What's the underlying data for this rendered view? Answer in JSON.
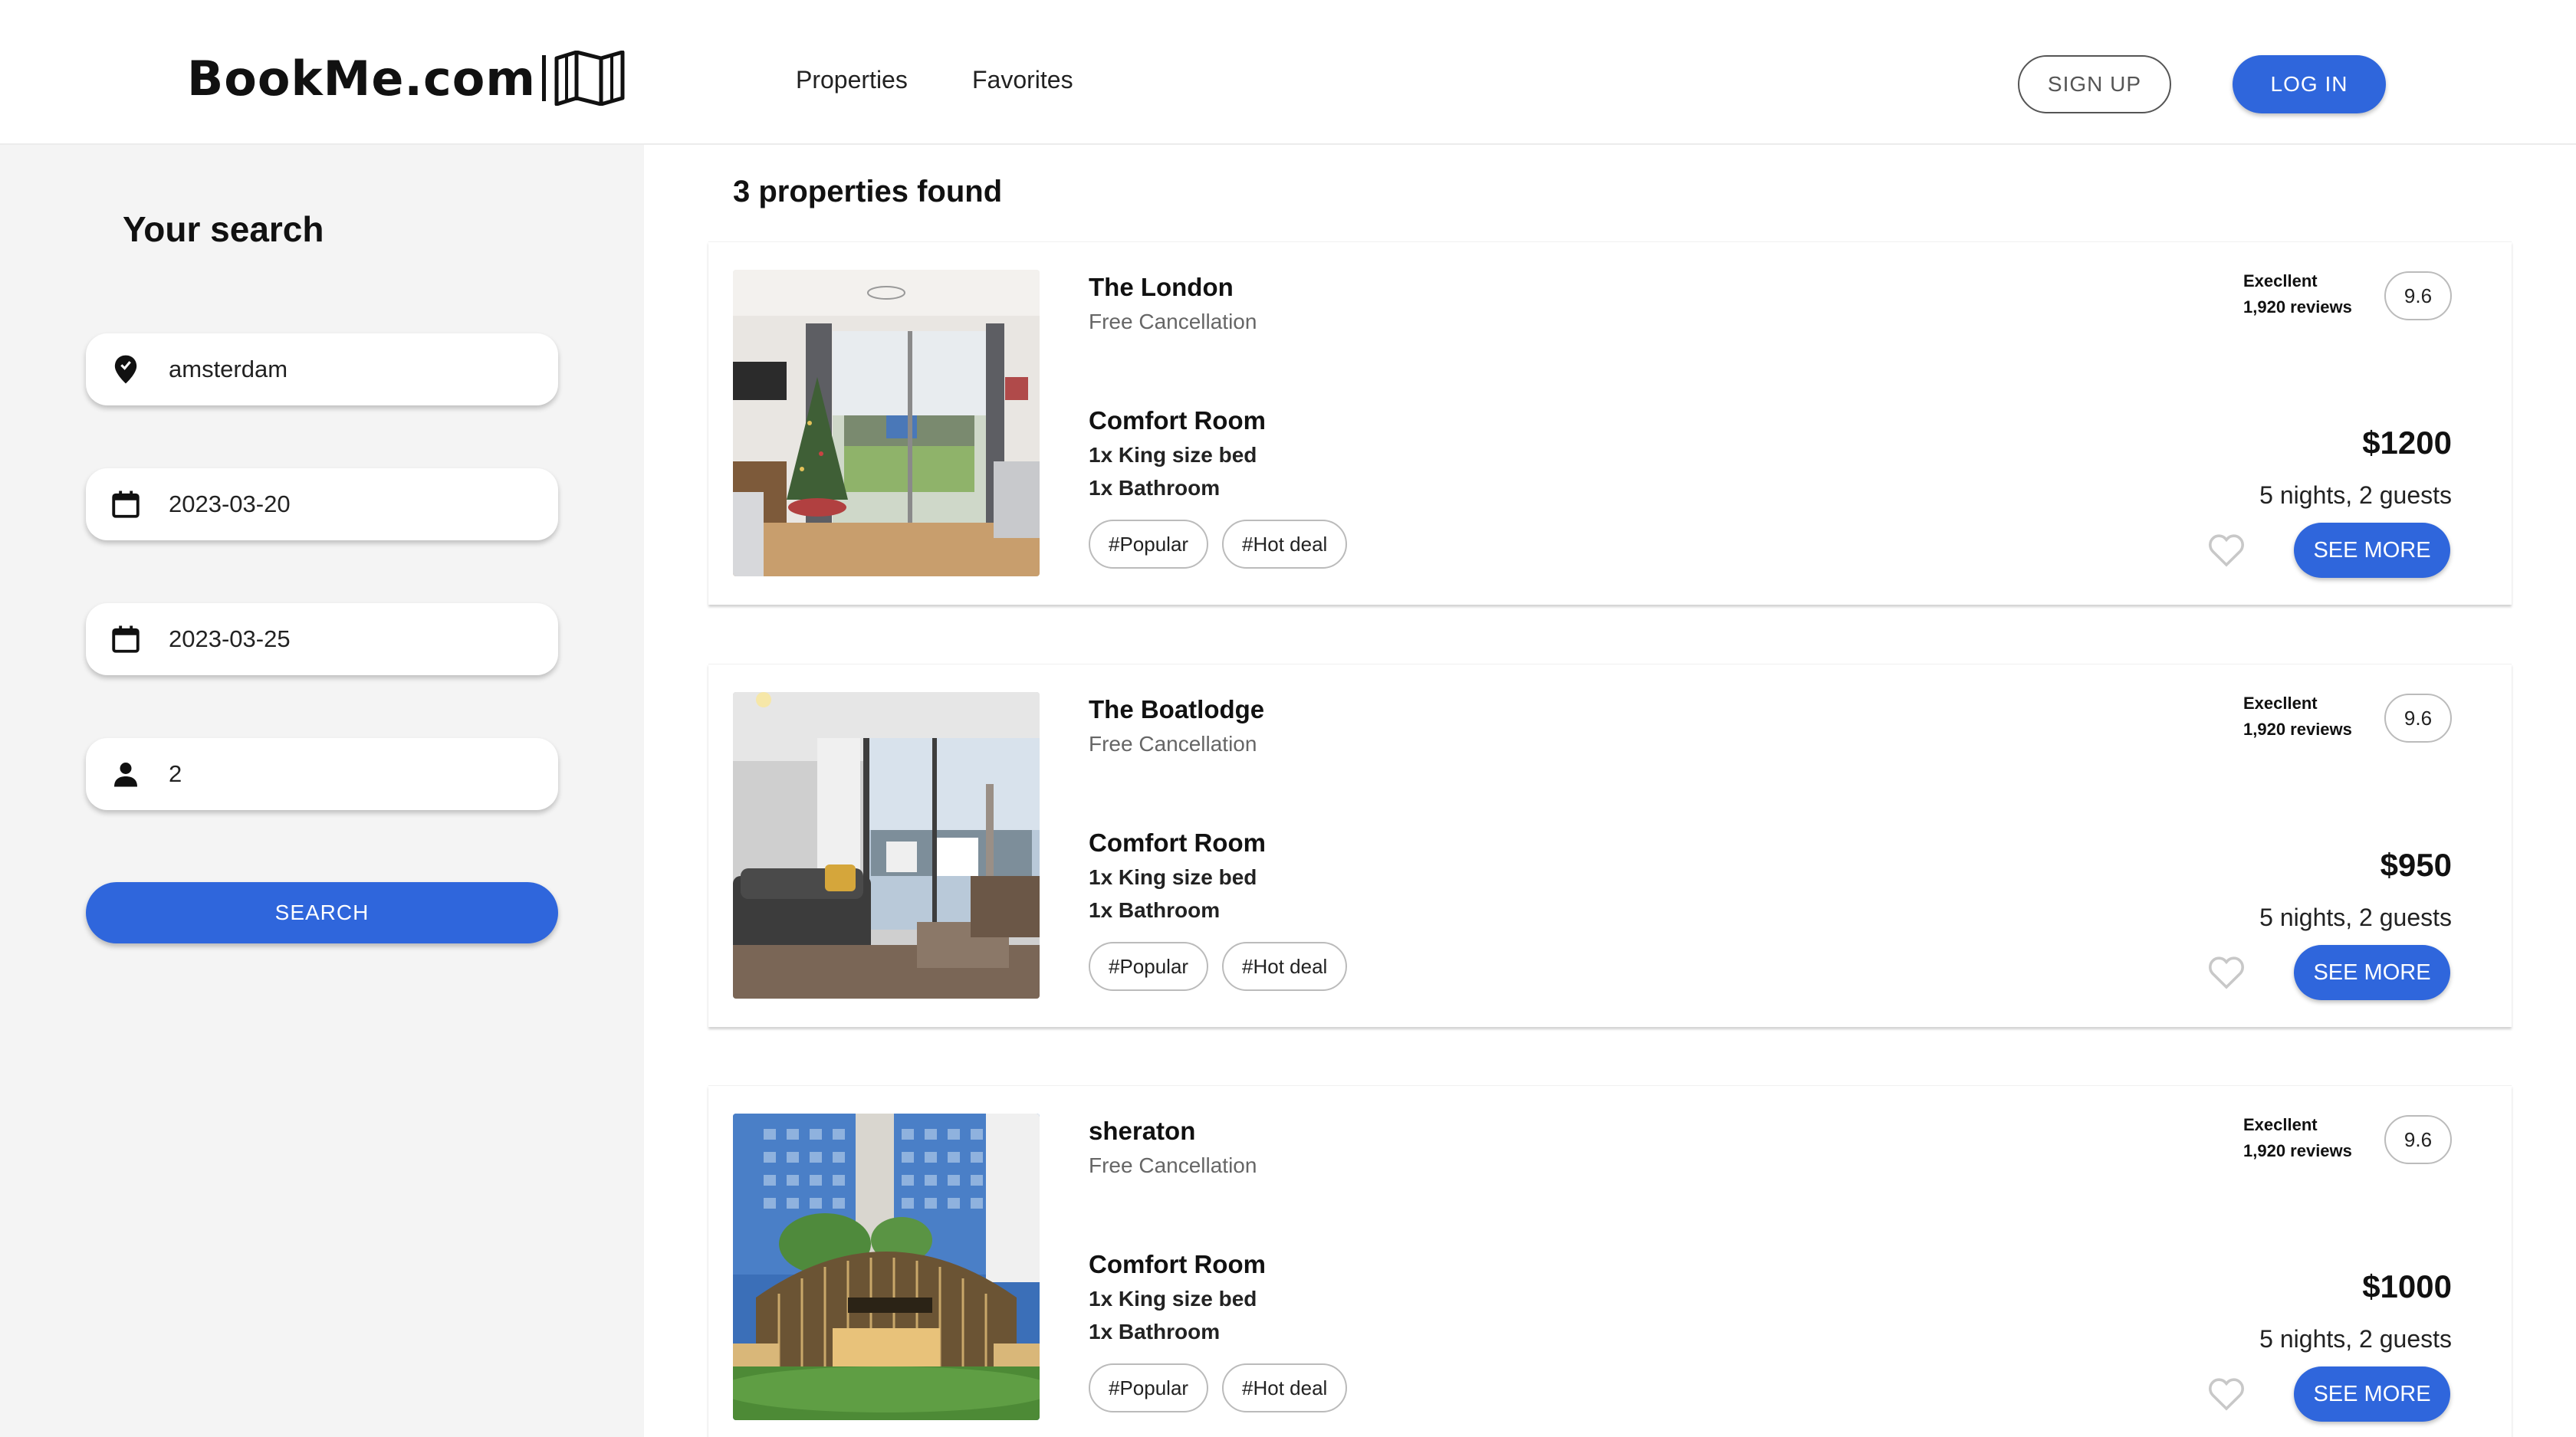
{
  "header": {
    "logo_text": "BookMe.com",
    "nav": [
      {
        "label": "Properties"
      },
      {
        "label": "Favorites"
      }
    ],
    "signup_label": "SIGN UP",
    "login_label": "LOG IN"
  },
  "sidebar": {
    "title": "Your search",
    "location": {
      "value": "amsterdam",
      "icon": "location-pin-icon"
    },
    "checkin": {
      "value": "2023-03-20",
      "icon": "calendar-icon"
    },
    "checkout": {
      "value": "2023-03-25",
      "icon": "calendar-icon"
    },
    "guests": {
      "value": "2",
      "icon": "person-icon"
    },
    "search_label": "SEARCH"
  },
  "results": {
    "title": "3 properties found",
    "items": [
      {
        "name": "The London",
        "cancellation": "Free Cancellation",
        "room": "Comfort Room",
        "bed": "1x King size bed",
        "bath": "1x Bathroom",
        "tags": [
          "#Popular",
          "#Hot deal"
        ],
        "rating_word": "Execllent",
        "reviews": "1,920 reviews",
        "score": "9.6",
        "price": "$1200",
        "stay": "5 nights, 2 guests",
        "more_label": "SEE MORE"
      },
      {
        "name": "The Boatlodge",
        "cancellation": "Free Cancellation",
        "room": "Comfort Room",
        "bed": "1x King size bed",
        "bath": "1x Bathroom",
        "tags": [
          "#Popular",
          "#Hot deal"
        ],
        "rating_word": "Execllent",
        "reviews": "1,920 reviews",
        "score": "9.6",
        "price": "$950",
        "stay": "5 nights, 2 guests",
        "more_label": "SEE MORE"
      },
      {
        "name": "sheraton",
        "cancellation": "Free Cancellation",
        "room": "Comfort Room",
        "bed": "1x King size bed",
        "bath": "1x Bathroom",
        "tags": [
          "#Popular",
          "#Hot deal"
        ],
        "rating_word": "Execllent",
        "reviews": "1,920 reviews",
        "score": "9.6",
        "price": "$1000",
        "stay": "5 nights, 2 guests",
        "more_label": "SEE MORE"
      }
    ]
  },
  "colors": {
    "accent": "#2f66dc",
    "sidebar_bg": "#f4f4f4"
  }
}
